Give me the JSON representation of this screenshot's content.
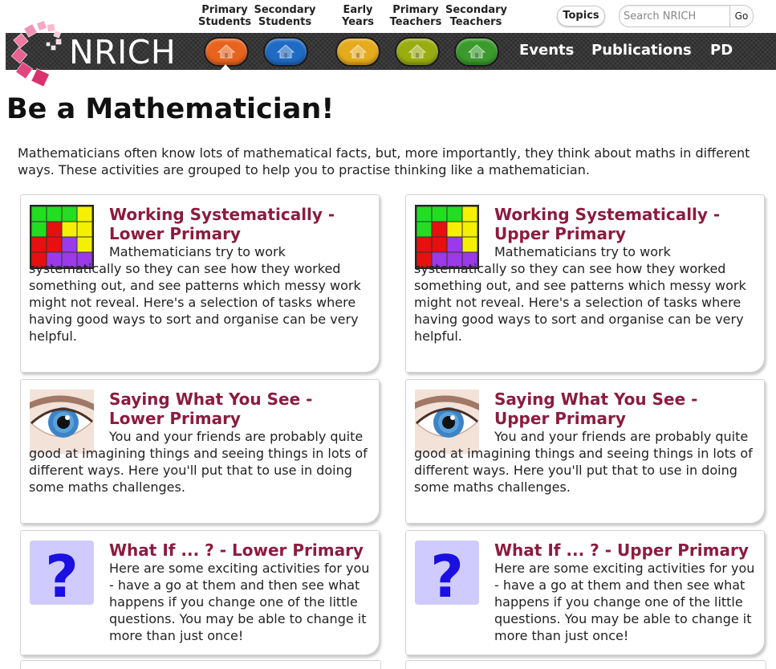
{
  "top_nav": [
    {
      "line1": "Primary",
      "line2": "Students"
    },
    {
      "line1": "Secondary",
      "line2": "Students"
    },
    {
      "line1": "Early",
      "line2": "Years"
    },
    {
      "line1": "Primary",
      "line2": "Teachers"
    },
    {
      "line1": "Secondary",
      "line2": "Teachers"
    }
  ],
  "topics_label": "Topics",
  "search": {
    "placeholder": "Search NRICH",
    "value": "",
    "go_label": "Go"
  },
  "logo": {
    "text": "NRICH"
  },
  "home_icons": [
    {
      "name": "primary-students-home-icon",
      "color": "#e8641e"
    },
    {
      "name": "secondary-students-home-icon",
      "color": "#1f6bc4"
    },
    {
      "name": "early-years-home-icon",
      "color": "#e4ab1c"
    },
    {
      "name": "primary-teachers-home-icon",
      "color": "#9aad10"
    },
    {
      "name": "secondary-teachers-home-icon",
      "color": "#3a9a2c"
    }
  ],
  "nav_links": [
    "Events",
    "Publications",
    "PD"
  ],
  "page_title": "Be a Mathematician!",
  "intro": "Mathematicians often know lots of mathematical facts, but, more importantly, they think about maths in different ways. These activities are grouped to help you to practise thinking like a mathematician.",
  "colors": {
    "title": "#8b1c3f",
    "navbar": "#2c2c2c"
  },
  "cards": [
    {
      "title": "Working Systematically - Lower Primary",
      "icon": "grid-puzzle-icon",
      "text": "Mathematicians try to work systematically so they can see how they worked something out, and see patterns which messy work might not reveal. Here's a selection of tasks where having good ways to sort and organise can be very helpful."
    },
    {
      "title": "Working Systematically - Upper Primary",
      "icon": "grid-puzzle-icon",
      "text": "Mathematicians try to work systematically so they can see how they worked something out, and see patterns which messy work might not reveal. Here's a selection of tasks where having good ways to sort and organise can be very helpful."
    },
    {
      "title": "Saying What You See - Lower Primary",
      "icon": "eye-icon",
      "text": "You and your friends are probably quite good at imagining things and seeing things in lots of different ways. Here you'll put that to use in doing some maths challenges."
    },
    {
      "title": "Saying What You See - Upper Primary",
      "icon": "eye-icon",
      "text": "You and your friends are probably quite good at imagining things and seeing things in lots of different ways. Here you'll put that to use in doing some maths challenges."
    },
    {
      "title": "What If ... ? - Lower Primary",
      "icon": "question-mark-icon",
      "text": "Here are some exciting activities for you - have a go at them and then see what happens if you change one of the little questions. You may be able to change it more than just once!"
    },
    {
      "title": "What If ... ? - Upper Primary",
      "icon": "question-mark-icon",
      "text": "Here are some exciting activities for you - have a go at them and then see what happens if you change one of the little questions. You may be able to change it more than just once!"
    }
  ]
}
